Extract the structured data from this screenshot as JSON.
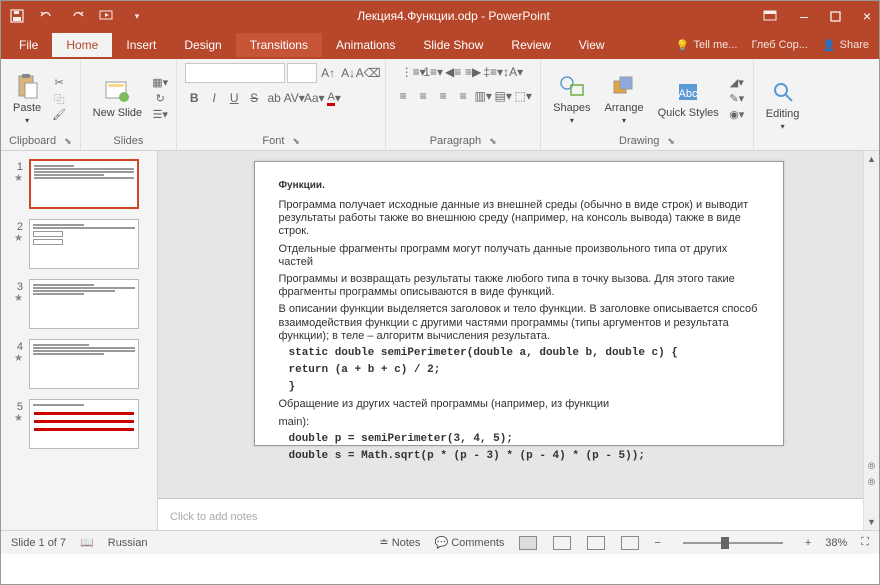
{
  "titlebar": {
    "filename": "Лекция4.Функции.odp - PowerPoint"
  },
  "tabs": {
    "file": "File",
    "home": "Home",
    "insert": "Insert",
    "design": "Design",
    "transitions": "Transitions",
    "animations": "Animations",
    "slideshow": "Slide Show",
    "review": "Review",
    "view": "View",
    "tellme": "Tell me...",
    "user": "Глеб Сор...",
    "share": "Share"
  },
  "ribbon": {
    "paste": "Paste",
    "newslide": "New Slide",
    "shapes": "Shapes",
    "arrange": "Arrange",
    "quickstyles": "Quick Styles",
    "editing": "Editing",
    "clipboard": "Clipboard",
    "slides": "Slides",
    "font": "Font",
    "paragraph": "Paragraph",
    "drawing": "Drawing"
  },
  "fontbtns": {
    "bold": "B",
    "italic": "I",
    "underline": "U",
    "strike": "S",
    "increase": "A",
    "decrease": "A"
  },
  "thumbs": [
    1,
    2,
    3,
    4,
    5
  ],
  "slide": {
    "title": "Функции.",
    "p1": "Программа получает исходные данные из внешней среды (обычно в виде строк) и выводит результаты работы также во внешнюю среду (например, на консоль вывода) также в виде строк.",
    "p2": "Отдельные фрагменты программ могут получать данные произвольного типа от других частей",
    "p3": "Программы и возвращать результаты также любого типа в точку вызова. Для этого такие фрагменты программы описываются в виде функций.",
    "p4": "В описании функции выделяется заголовок и тело функции. В заголовке описывается способ взаимодействия функции с другими частями программы (типы аргументов и результата функции); в теле – алгоритм вычисления результата.",
    "code1a": "static double semiPerimeter(double a, double b, double c) {",
    "code1b": "  return (a + b + c) / 2;",
    "code1c": "}",
    "p5": "Обращение из других частей программы (например, из функции",
    "p6": "main):",
    "code2a": "double p = semiPerimeter(3, 4, 5);",
    "code2b": "double s = Math.sqrt(p * (p - 3) * (p - 4) * (p - 5));"
  },
  "notes": {
    "placeholder": "Click to add notes"
  },
  "status": {
    "slide": "Slide 1 of 7",
    "lang": "Russian",
    "notes": "Notes",
    "comments": "Comments",
    "zoom": "38%"
  }
}
